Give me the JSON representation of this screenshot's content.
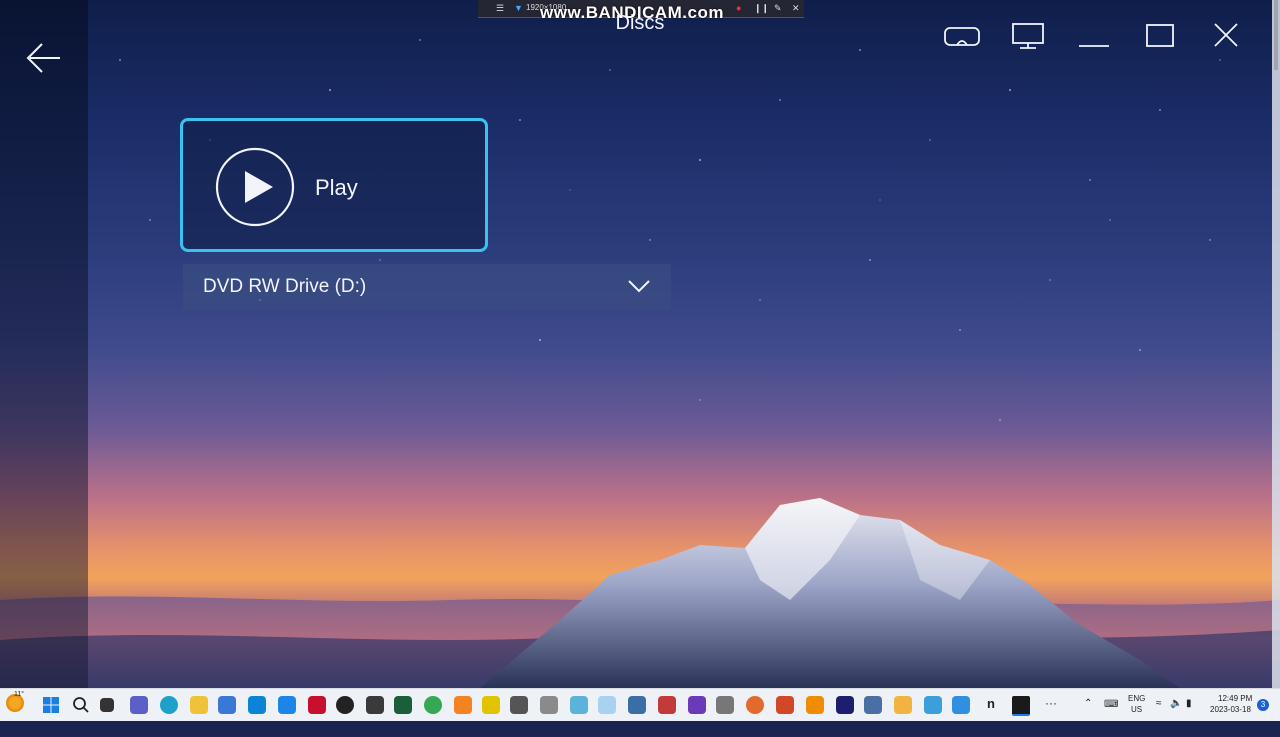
{
  "recorder": {
    "resolution": "1920×1080",
    "watermark": "www.BANDICAM.com"
  },
  "header": {
    "title": "Discs"
  },
  "play_card": {
    "label": "Play"
  },
  "drive": {
    "selected": "DVD RW Drive (D:)"
  },
  "taskbar": {
    "weather_temp": "11°",
    "language": "ENG",
    "region": "US",
    "time": "12:49 PM",
    "date": "2023-03-18",
    "notification_count": "3",
    "more_label": "···"
  },
  "colors": {
    "accent": "#3cc2ef",
    "sky_top": "#0f1e4a",
    "sunset": "#f1a35c",
    "taskbar": "#eef1f6"
  },
  "icons": [
    "back-arrow-icon",
    "vr-headset-icon",
    "monitor-icon",
    "minimize-icon",
    "maximize-icon",
    "close-icon",
    "play-icon",
    "chevron-down-icon",
    "windows-start-icon",
    "search-icon",
    "task-view-icon",
    "chat-icon",
    "edge-icon",
    "file-explorer-icon",
    "store-icon"
  ]
}
